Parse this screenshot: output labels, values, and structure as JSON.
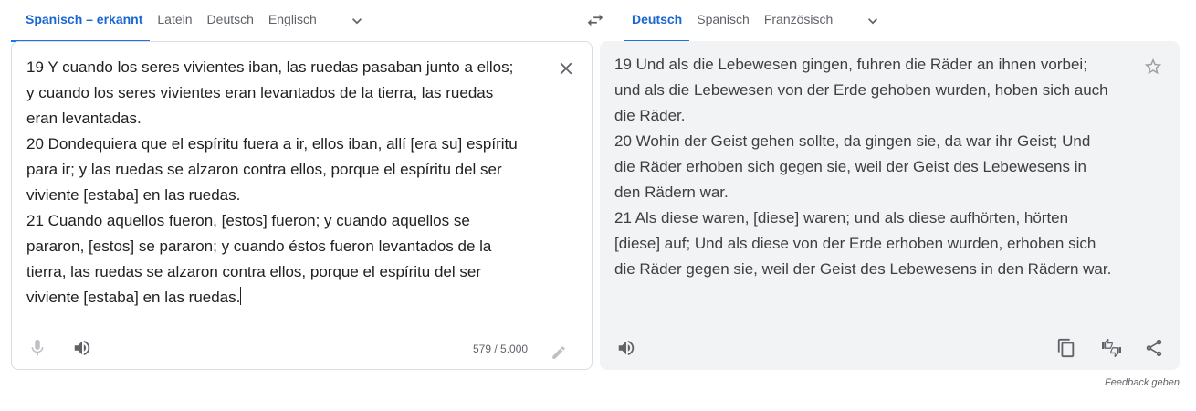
{
  "source_tabs": [
    "Spanisch – erkannt",
    "Latein",
    "Deutsch",
    "Englisch"
  ],
  "target_tabs": [
    "Deutsch",
    "Spanisch",
    "Französisch"
  ],
  "icons": {
    "more_source_languages": "chevron-down-icon",
    "swap": "swap-languages-icon",
    "more_target_languages": "chevron-down-icon",
    "clear": "close-icon",
    "microphone": "microphone-icon",
    "listen_source": "speaker-icon",
    "edit": "pencil-icon",
    "save": "star-icon",
    "listen_target": "speaker-icon",
    "copy": "copy-icon",
    "rate": "thumbs-up-down-icon",
    "share": "share-icon"
  },
  "source": {
    "text": "19 Y cuando los seres vivientes iban, las ruedas pasaban junto a ellos;\ny cuando los seres vivientes eran levantados de la tierra, las ruedas\neran levantadas.\n20 Dondequiera que el espíritu fuera a ir, ellos iban, allí [era su] espíritu\npara ir; y las ruedas se alzaron contra ellos, porque el espíritu del ser\nviviente [estaba] en las ruedas.\n21 Cuando aquellos fueron, [estos] fueron; y cuando aquellos se\npararon, [estos] se pararon; y cuando éstos fueron levantados de la\ntierra, las ruedas se alzaron contra ellos, porque el espíritu del ser\nviviente [estaba] en las ruedas.",
    "char_count": "579 / 5.000"
  },
  "target": {
    "text": "19 Und als die Lebewesen gingen, fuhren die Räder an ihnen vorbei;\nund als die Lebewesen von der Erde gehoben wurden, hoben sich auch\ndie Räder.\n20 Wohin der Geist gehen sollte, da gingen sie, da war ihr Geist; Und\ndie Räder erhoben sich gegen sie, weil der Geist des Lebewesens in\nden Rädern war.\n21 Als diese waren, [diese] waren; und als diese aufhörten, hörten\n[diese] auf; Und als diese von der Erde erhoben wurden, erhoben sich\ndie Räder gegen sie, weil der Geist des Lebewesens in den Rädern war."
  },
  "feedback_label": "Feedback geben",
  "colors": {
    "accent": "#1a73e8",
    "target_bg": "#f1f3f4",
    "border": "#dadce0"
  }
}
